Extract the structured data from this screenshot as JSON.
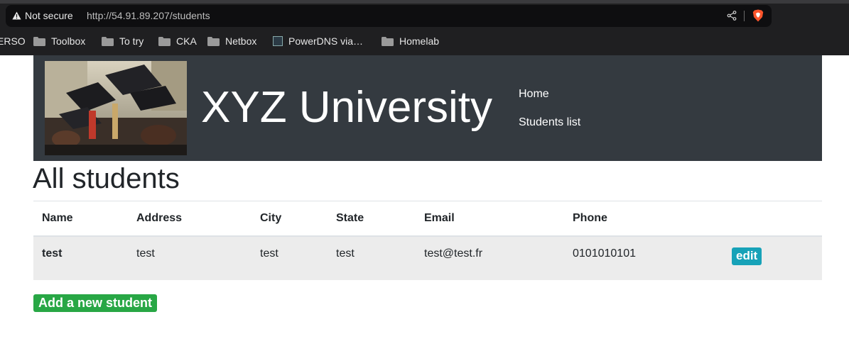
{
  "browser": {
    "security_label": "Not secure",
    "url": "http://54.91.89.207/students",
    "bookmarks": [
      "ERSO",
      "Toolbox",
      "To try",
      "CKA",
      "Netbox",
      "PowerDNS via…",
      "Homelab"
    ]
  },
  "site": {
    "title": "XYZ University",
    "nav": {
      "home": "Home",
      "students_list": "Students list"
    }
  },
  "page": {
    "heading": "All students"
  },
  "table": {
    "headers": [
      "Name",
      "Address",
      "City",
      "State",
      "Email",
      "Phone"
    ],
    "rows": [
      {
        "name": "test",
        "address": "test",
        "city": "test",
        "state": "test",
        "email": "test@test.fr",
        "phone": "0101010101",
        "action": "edit"
      }
    ]
  },
  "actions": {
    "add_student": "Add a new student"
  },
  "colors": {
    "header_bg": "#343a40",
    "edit_button": "#17a2b8",
    "add_button": "#28a745"
  }
}
